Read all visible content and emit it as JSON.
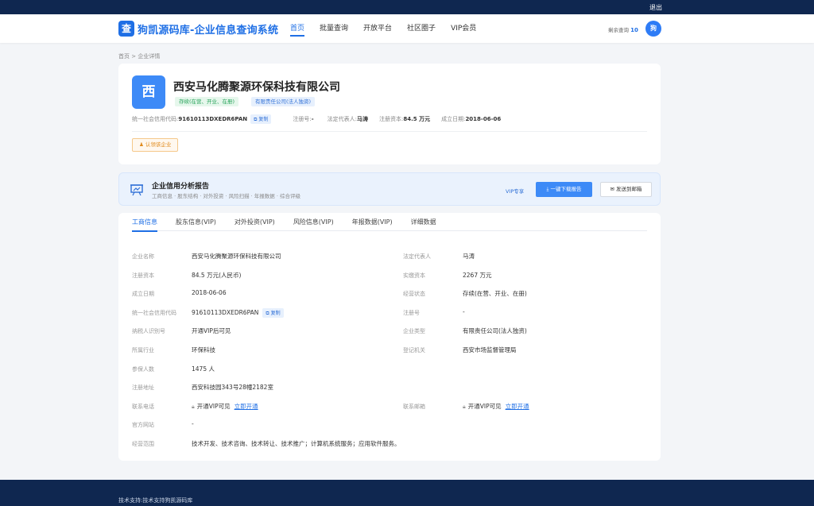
{
  "topbar": {
    "logout": "退出"
  },
  "header": {
    "logo_char": "查",
    "title": "狗凯源码库-企业信息查询系统",
    "nav": [
      "首页",
      "批量查询",
      "开放平台",
      "社区圈子",
      "VIP会员"
    ],
    "quota_label": "剩余查询",
    "quota_value": "10",
    "avatar_char": "狗"
  },
  "breadcrumb": "首页 > 企业详情",
  "company": {
    "avatar_char": "西",
    "name": "西安马化腾聚源环保科技有限公司",
    "status_tag": "存续(在营、开业、在册)",
    "type_tag": "有限责任公司(法人独资)",
    "credit_code_label": "统一社会信用代码:",
    "credit_code": "91610113DXEDR6PAN",
    "copy": "复制",
    "reg_no_label": "注册号:",
    "reg_no": "-",
    "legal_rep_label": "法定代表人:",
    "legal_rep": "马涛",
    "capital_label": "注册资本:",
    "capital": "84.5 万元",
    "date_label": "成立日期:",
    "date": "2018-06-06",
    "claim": "认领该企业"
  },
  "report": {
    "title": "企业信用分析报告",
    "subtitle": "工商信息 · 股东结构 · 对外投资 · 风险扫描 · 年报数据 · 综合评级",
    "vip": "VIP专享",
    "download": "一键下载报告",
    "email": "发送到邮箱"
  },
  "tabs": [
    "工商信息",
    "股东信息(VIP)",
    "对外投资(VIP)",
    "风险信息(VIP)",
    "年报数据(VIP)",
    "详细数据"
  ],
  "fields": {
    "name_l": "企业名称",
    "name_v": "西安马化腾聚源环保科技有限公司",
    "legal_l": "法定代表人",
    "legal_v": "马涛",
    "capital_l": "注册资本",
    "capital_v": "84.5 万元(人民币)",
    "paid_l": "实缴资本",
    "paid_v": "2267 万元",
    "date_l": "成立日期",
    "date_v": "2018-06-06",
    "status_l": "经营状态",
    "status_v": "存续(在营、开业、在册)",
    "code_l": "统一社会信用代码",
    "code_v": "91610113DXEDR6PAN",
    "code_copy": "复制",
    "regno_l": "注册号",
    "regno_v": "-",
    "tax_l": "纳税人识别号",
    "tax_v": "开通VIP后可见",
    "type_l": "企业类型",
    "type_v": "有限责任公司(法人独资)",
    "industry_l": "所属行业",
    "industry_v": "环保科技",
    "authority_l": "登记机关",
    "authority_v": "西安市场监督管理局",
    "insured_l": "参保人数",
    "insured_v": "1475 人",
    "address_l": "注册地址",
    "address_v": "西安科技园343号28幢2182室",
    "phone_l": "联系电话",
    "phone_v": "开通VIP可见",
    "phone_link": "立即开通",
    "email_l": "联系邮箱",
    "email_v": "开通VIP可见",
    "email_link": "立即开通",
    "web_l": "官方网站",
    "web_v": "-",
    "scope_l": "经营范围",
    "scope_v": "技术开发、技术咨询、技术转让、技术推广；计算机系统服务；应用软件服务。"
  },
  "footer": "技术支持:技术支持狗凯源码库"
}
